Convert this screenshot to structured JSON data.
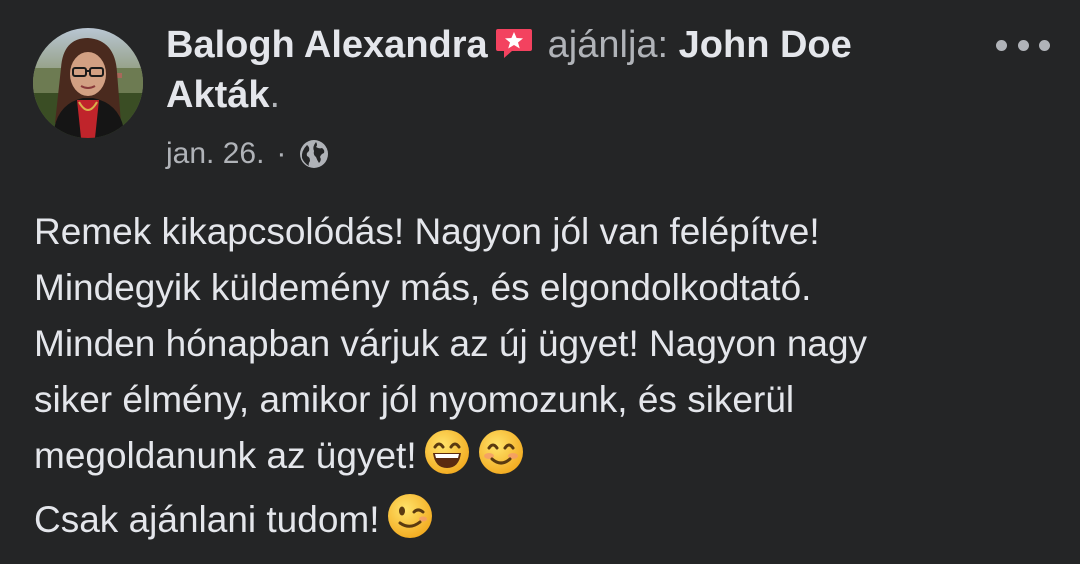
{
  "post": {
    "author": "Balogh Alexandra",
    "recommends_text": "ajánlja:",
    "page_name": "John Doe Akták",
    "page_suffix": ".",
    "date": "jan. 26.",
    "separator": "·",
    "privacy_icon": "globe-icon",
    "recommendation_icon": "recommend-badge-icon",
    "more_icon": "more-options-icon",
    "lines": [
      "Remek kikapcsolódás! Nagyon jól van felépítve!",
      "Mindegyik küldemény más, és elgondolkodtató.",
      "Minden hónapban várjuk az új ügyet! Nagyon nagy",
      "siker élmény, amikor jól nyomozunk, és sikerül",
      "megoldanunk az ügyet!",
      "Csak ajánlani tudom!"
    ],
    "emojis": {
      "line5": [
        "grinning-face-emoji",
        "smiling-face-emoji"
      ],
      "line6": [
        "winking-face-emoji"
      ]
    }
  },
  "colors": {
    "background": "#242526",
    "primary_text": "#e4e6eb",
    "secondary_text": "#b0b3b8",
    "recommend_badge": "#f3425f"
  }
}
